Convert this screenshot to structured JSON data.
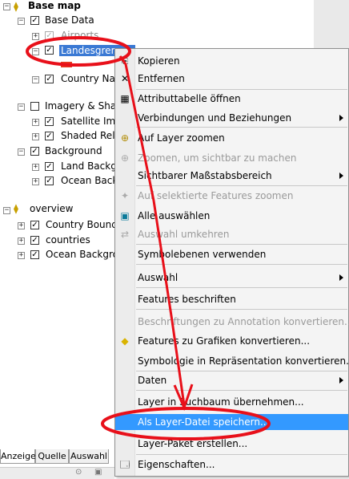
{
  "toc": {
    "groups": [
      {
        "label": "Base map",
        "bold": true
      },
      {
        "label": "Base Data"
      },
      {
        "label": "Airports"
      },
      {
        "label": "Landesgrenzen"
      },
      {
        "label": "Country Nam"
      },
      {
        "label": "Imagery & Shad"
      },
      {
        "label": "Satellite Imag"
      },
      {
        "label": "Shaded Relie"
      },
      {
        "label": "Background"
      },
      {
        "label": "Land Backgr"
      },
      {
        "label": "Ocean Backg"
      },
      {
        "label": "overview"
      },
      {
        "label": "Country Bounda"
      },
      {
        "label": "countries"
      },
      {
        "label": "Ocean Backgrou"
      }
    ],
    "symbol_color": "#e83c20"
  },
  "tabs": [
    "Anzeige",
    "Quelle",
    "Auswahl"
  ],
  "menu": {
    "items": [
      {
        "label": "Kopieren",
        "icon": "copy-icon",
        "glyph": "📋"
      },
      {
        "label": "Entfernen",
        "icon": "remove-icon",
        "glyph": "✕"
      },
      {
        "label": "Attributtabelle öffnen",
        "icon": "table-icon",
        "glyph": "▦"
      },
      {
        "label": "Verbindungen und Beziehungen"
      },
      {
        "label": "Auf Layer zoomen",
        "icon": "zoom-layer-icon",
        "glyph": "🔍"
      },
      {
        "label": "Zoomen, um sichtbar zu machen",
        "icon": "zoom-visible-icon",
        "glyph": "🔍"
      },
      {
        "label": "Sichtbarer Maßstabsbereich"
      },
      {
        "label": "Auf selektierte Features zoomen",
        "icon": "zoom-selected-icon",
        "glyph": "✦"
      },
      {
        "label": "Alle auswählen",
        "icon": "select-all-icon",
        "glyph": "▣"
      },
      {
        "label": "Auswahl umkehren",
        "icon": "switch-selection-icon",
        "glyph": "⇄"
      },
      {
        "label": "Symbolebenen verwenden"
      },
      {
        "label": "Auswahl"
      },
      {
        "label": "Features beschriften"
      },
      {
        "label": "Beschriftungen zu Annotation konvertieren..."
      },
      {
        "label": "Features zu Grafiken konvertieren...",
        "icon": "convert-graphics-icon",
        "glyph": "◆"
      },
      {
        "label": "Symbologie in Repräsentation konvertieren..."
      },
      {
        "label": "Daten"
      },
      {
        "label": "Layer in Suchbaum übernehmen..."
      },
      {
        "label": "Als Layer-Datei speichern..."
      },
      {
        "label": "Layer-Paket erstellen..."
      },
      {
        "label": "Eigenschaften...",
        "icon": "properties-icon",
        "glyph": "🗔"
      }
    ]
  },
  "colors": {
    "annotation_red": "#e8101a",
    "highlight": "#3399ff",
    "selection": "#3a79d4"
  }
}
